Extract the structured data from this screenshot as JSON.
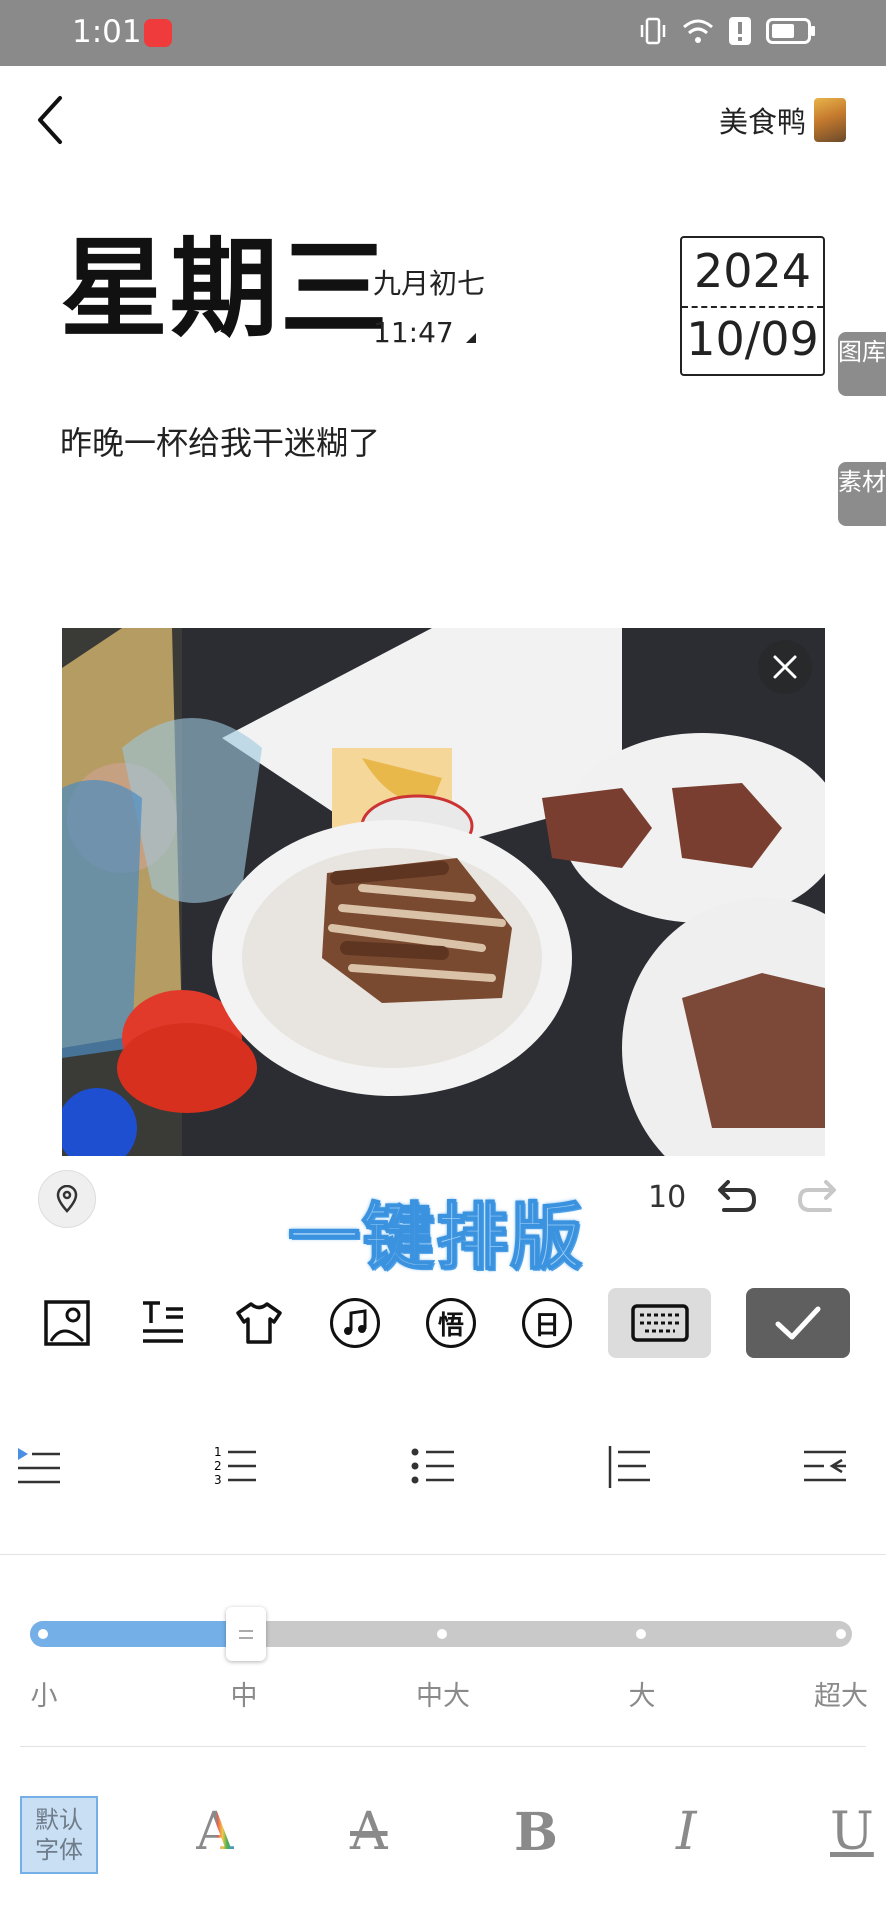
{
  "status_bar": {
    "time": "1:01"
  },
  "header": {
    "author": "美食鸭"
  },
  "entry": {
    "weekday": "星期三",
    "lunar_date": "九月初七",
    "time": "11:47",
    "year": "2024",
    "month_day": "10/09",
    "text": "昨晚一杯给我干迷糊了"
  },
  "side_tabs": {
    "gallery": "图库",
    "material": "素材"
  },
  "editor": {
    "one_key_layout": "一键排版",
    "count": "10",
    "toolbar_circle_1": "悟",
    "toolbar_circle_2": "日"
  },
  "font_size": {
    "labels": [
      "小",
      "中",
      "中大",
      "大",
      "超大"
    ],
    "selected": "中",
    "selected_index": 1
  },
  "font": {
    "default_line1": "默认",
    "default_line2": "字体",
    "bold": "B",
    "italic": "I",
    "underline": "U",
    "color_A": "A",
    "clear_A": "A"
  },
  "colors": {
    "accent_blue": "#75afe8",
    "status_bar": "#8a8a8a",
    "confirm_button": "#5f5f5f"
  }
}
